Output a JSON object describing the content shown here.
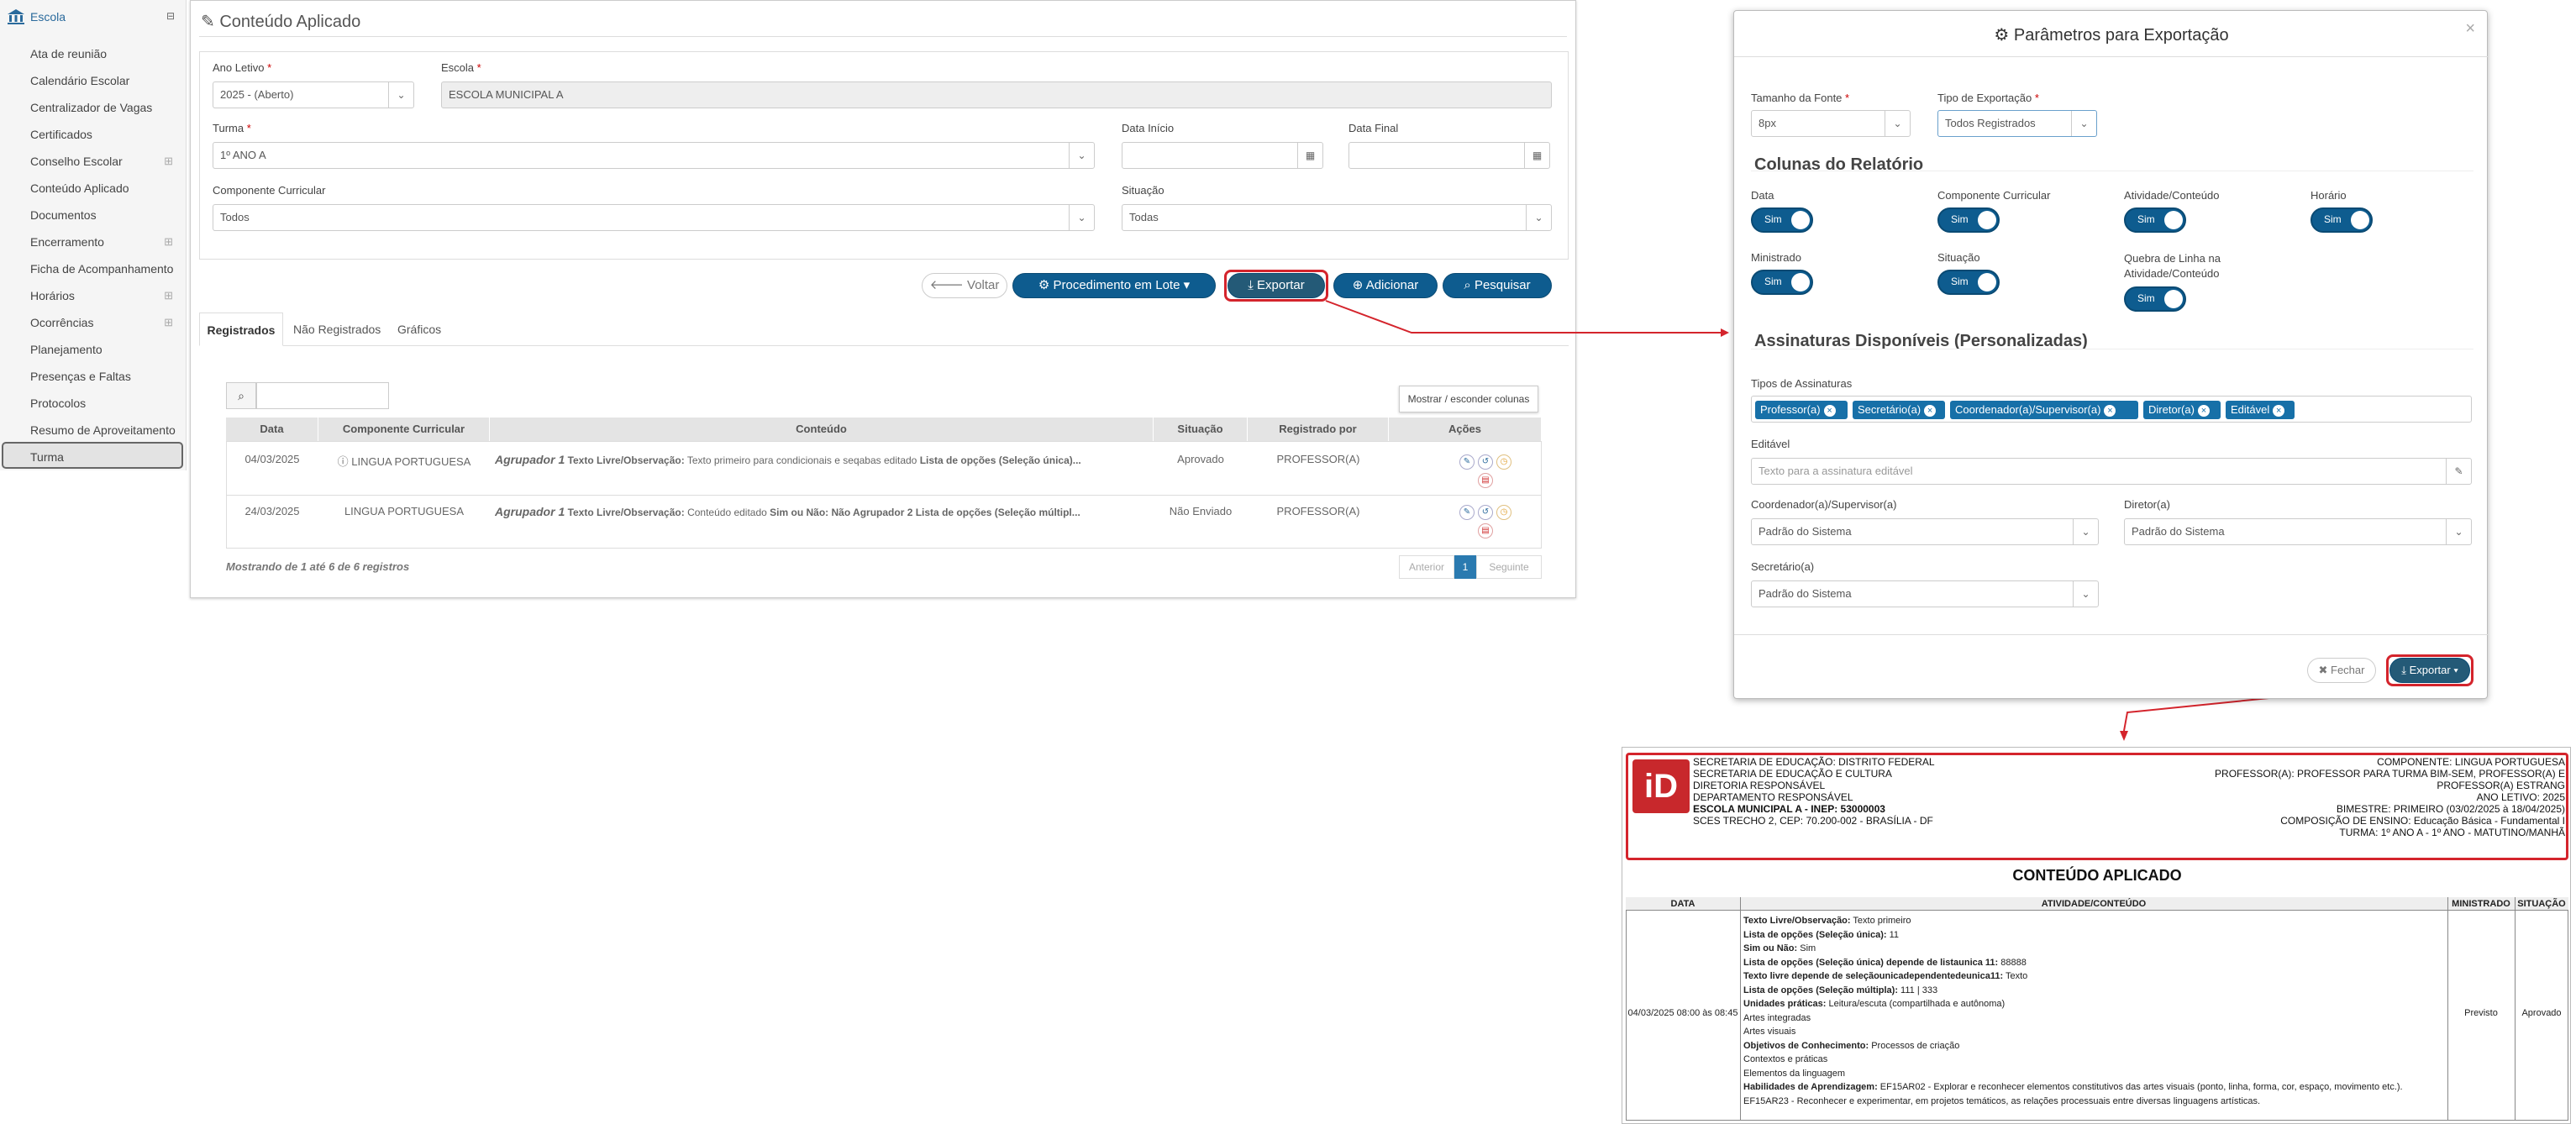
{
  "sidebar": {
    "header": "Escola",
    "items": [
      "Ata de reunião",
      "Calendário Escolar",
      "Centralizador de Vagas",
      "Certificados",
      "Conselho Escolar",
      "Conteúdo Aplicado",
      "Documentos",
      "Encerramento",
      "Ficha de Acompanhamento",
      "Horários",
      "Ocorrências",
      "Planejamento",
      "Presenças e Faltas",
      "Protocolos",
      "Resumo de Aproveitamento",
      "Turma"
    ]
  },
  "main": {
    "title": "Conteúdo Aplicado",
    "ano_letivo_label": "Ano Letivo",
    "ano_letivo_value": "2025 - (Aberto)",
    "escola_label": "Escola",
    "escola_value": "ESCOLA MUNICIPAL A",
    "turma_label": "Turma",
    "turma_value": "1º ANO A",
    "data_inicio_label": "Data Início",
    "data_final_label": "Data Final",
    "componente_label": "Componente Curricular",
    "componente_value": "Todos",
    "situacao_label": "Situação",
    "situacao_value": "Todas",
    "buttons": {
      "voltar": "Voltar",
      "lote": "Procedimento em Lote",
      "exportar": "Exportar",
      "adicionar": "Adicionar",
      "pesquisar": "Pesquisar"
    },
    "tabs": [
      "Registrados",
      "Não Registrados",
      "Gráficos"
    ],
    "toggle_columns": "Mostrar / esconder colunas",
    "columns": [
      "Data",
      "Componente Curricular",
      "Conteúdo",
      "Situação",
      "Registrado por",
      "Ações"
    ],
    "rows": [
      {
        "data": "04/03/2025",
        "componente": "LINGUA PORTUGUESA",
        "conteudo_a": "Agrupador 1",
        "conteudo_b": " Texto Livre/Observação:",
        "conteudo_c": " Texto primeiro para condicionais e seqabas editado ",
        "conteudo_d": "Lista de opções (Seleção única)...",
        "situacao": "Aprovado",
        "registrado": "PROFESSOR(A)"
      },
      {
        "data": "24/03/2025",
        "componente": "LINGUA PORTUGUESA",
        "conteudo_a": "Agrupador 1",
        "conteudo_b": " Texto Livre/Observação:",
        "conteudo_c": " Conteúdo editado ",
        "conteudo_d": "Sim ou Não: Não Agrupador 2 Lista de opções (Seleção múltipl...",
        "situacao": "Não Enviado",
        "registrado": "PROFESSOR(A)"
      }
    ],
    "footer": "Mostrando de 1 até 6 de 6 registros",
    "pagination": {
      "prev": "Anterior",
      "page": "1",
      "next": "Seguinte"
    }
  },
  "modal": {
    "title": "Parâmetros para Exportação",
    "close": "×",
    "tamanho_label": "Tamanho da Fonte",
    "tamanho_value": "8px",
    "tipo_label": "Tipo de Exportação",
    "tipo_value": "Todos Registrados",
    "colunas_title": "Colunas do Relatório",
    "switches": [
      {
        "label": "Data",
        "value": "Sim"
      },
      {
        "label": "Componente Curricular",
        "value": "Sim"
      },
      {
        "label": "Atividade/Conteúdo",
        "value": "Sim"
      },
      {
        "label": "Horário",
        "value": "Sim"
      },
      {
        "label": "Ministrado",
        "value": "Sim"
      },
      {
        "label": "Situação",
        "value": "Sim"
      },
      {
        "label": "Quebra de Linha na Atividade/Conteúdo",
        "value": "Sim"
      }
    ],
    "assinaturas_title": "Assinaturas Disponíveis (Personalizadas)",
    "tipos_label": "Tipos de Assinaturas",
    "chips": [
      "Professor(a)",
      "Secretário(a)",
      "Coordenador(a)/Supervisor(a)",
      "Diretor(a)",
      "Editável"
    ],
    "editavel_label": "Editável",
    "editavel_placeholder": "Texto para a assinatura editável",
    "coord_label": "Coordenador(a)/Supervisor(a)",
    "coord_value": "Padrão do Sistema",
    "diretor_label": "Diretor(a)",
    "diretor_value": "Padrão do Sistema",
    "secretario_label": "Secretário(a)",
    "secretario_value": "Padrão do Sistema",
    "fechar": "Fechar",
    "exportar": "Exportar"
  },
  "report": {
    "left_lines": [
      "SECRETARIA DE EDUCAÇÃO: DISTRITO FEDERAL",
      "SECRETARIA DE EDUCAÇÃO E CULTURA",
      "DIRETORIA RESPONSÁVEL",
      "DEPARTAMENTO RESPONSÁVEL",
      "ESCOLA MUNICIPAL A - INEP: 53000003",
      "SCES TRECHO 2, CEP: 70.200-002 - BRASÍLIA - DF"
    ],
    "right_lines": [
      "COMPONENTE: LINGUA PORTUGUESA",
      "PROFESSOR(A): PROFESSOR PARA TURMA BIM-SEM, PROFESSOR(A) E",
      "PROFESSOR(A) ESTRANG",
      "ANO LETIVO: 2025",
      "BIMESTRE: PRIMEIRO (03/02/2025 à 18/04/2025)",
      "COMPOSIÇÃO DE ENSINO: Educação Básica - Fundamental I",
      "TURMA: 1º ANO A - 1º ANO - MATUTINO/MANHÃ"
    ],
    "title": "CONTEÚDO APLICADO",
    "headers": [
      "DATA",
      "ATIVIDADE/CONTEÚDO",
      "MINISTRADO",
      "SITUAÇÃO"
    ],
    "row_date": "04/03/2025 08:00 às 08:45",
    "lines": [
      [
        "Texto Livre/Observação:",
        " Texto primeiro"
      ],
      [
        "Lista de opções (Seleção única):",
        " 11"
      ],
      [
        "Sim ou Não:",
        " Sim"
      ],
      [
        "Lista de opções (Seleção única) depende de listaunica 11:",
        " 88888"
      ],
      [
        "Texto livre depende de seleçãounicadependentedeunica11:",
        " Texto"
      ],
      [
        "Lista de opções (Seleção múltipla):",
        " 111 | 333"
      ],
      [
        "Unidades práticas:",
        " Leitura/escuta (compartilhada e autônoma)"
      ],
      [
        "",
        " Artes integradas"
      ],
      [
        "",
        " Artes visuais"
      ],
      [
        "Objetivos de Conhecimento:",
        " Processos de criação"
      ],
      [
        "",
        " Contextos e práticas"
      ],
      [
        "",
        " Elementos da linguagem"
      ],
      [
        "Habilidades de Aprendizagem:",
        " EF15AR02 - Explorar e reconhecer elementos constitutivos das artes visuais (ponto, linha, forma, cor, espaço, movimento etc.)."
      ],
      [
        "",
        " EF15AR23 - Reconhecer e experimentar, em projetos temáticos, as relações processuais entre diversas linguagens artísticas."
      ]
    ],
    "ministrado": "Previsto",
    "situacao": "Aprovado"
  },
  "colors": {
    "primary": "#0e5c8f",
    "highlight": "#d4242c"
  }
}
